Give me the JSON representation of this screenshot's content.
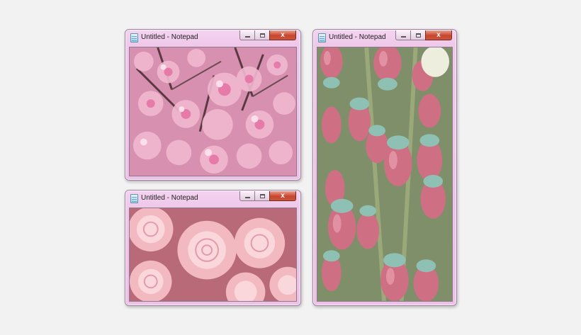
{
  "windows": [
    {
      "title": "Untitled - Notepad",
      "image": "pink cherry blossoms photo"
    },
    {
      "title": "Untitled - Notepad",
      "image": "pink rose cluster photo"
    },
    {
      "title": "Untitled - Notepad",
      "image": "pink bell-shaped flower buds photo"
    }
  ],
  "controls": {
    "close_glyph": "x"
  },
  "colors": {
    "frame": "#ecc2e6",
    "close_button": "#c9452d"
  }
}
